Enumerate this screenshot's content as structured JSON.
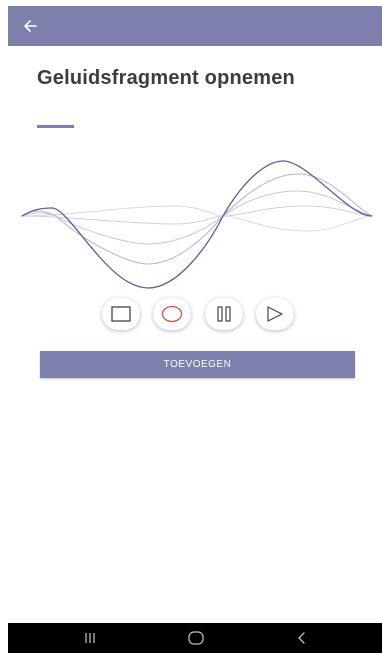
{
  "app_bar": {
    "color": "#7c80ab",
    "back_icon": "arrow-left-icon"
  },
  "page": {
    "title": "Geluidsfragment opnemen"
  },
  "waveform": {
    "line_color": "#5d6092",
    "curves": 5
  },
  "controls": [
    {
      "name": "stop",
      "icon": "square-icon"
    },
    {
      "name": "record",
      "icon": "circle-icon",
      "color": "#d9534f"
    },
    {
      "name": "pause",
      "icon": "pause-icon"
    },
    {
      "name": "play",
      "icon": "play-icon"
    }
  ],
  "actions": {
    "add_label": "TOEVOEGEN"
  },
  "system_nav": {
    "recent_icon": "recent-apps-icon",
    "home_icon": "home-icon",
    "back_icon": "back-chevron-icon"
  }
}
